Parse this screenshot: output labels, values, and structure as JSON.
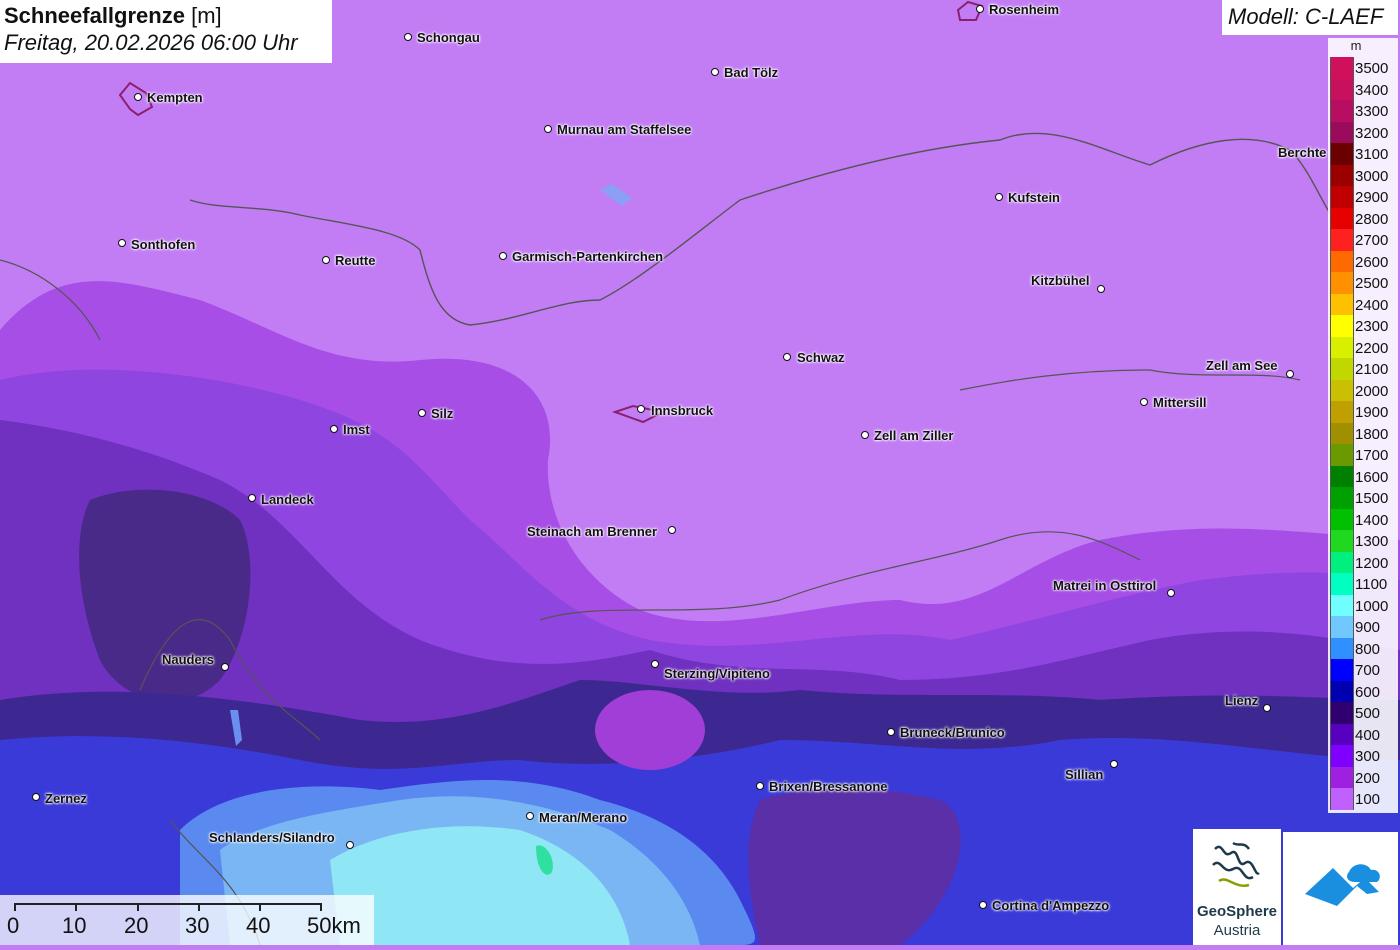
{
  "title": {
    "main": "Schneefallgrenze",
    "unit": "[m]",
    "datetime": "Freitag, 20.02.2026 06:00 Uhr"
  },
  "model": "Modell: C-LAEF",
  "legend": {
    "unit": "m",
    "entries": [
      {
        "label": "3500",
        "color": "#d0105a"
      },
      {
        "label": "3400",
        "color": "#c8105e"
      },
      {
        "label": "3300",
        "color": "#b80e62"
      },
      {
        "label": "3200",
        "color": "#9c0a5e"
      },
      {
        "label": "3100",
        "color": "#6b0000"
      },
      {
        "label": "3000",
        "color": "#9a0000"
      },
      {
        "label": "2900",
        "color": "#c00000"
      },
      {
        "label": "2800",
        "color": "#e60000"
      },
      {
        "label": "2700",
        "color": "#ff2020"
      },
      {
        "label": "2600",
        "color": "#ff6a00"
      },
      {
        "label": "2500",
        "color": "#ff9000"
      },
      {
        "label": "2400",
        "color": "#ffc000"
      },
      {
        "label": "2300",
        "color": "#ffff00"
      },
      {
        "label": "2200",
        "color": "#d8f000"
      },
      {
        "label": "2100",
        "color": "#c0d800"
      },
      {
        "label": "2000",
        "color": "#c8c000"
      },
      {
        "label": "1900",
        "color": "#c0a000"
      },
      {
        "label": "1800",
        "color": "#a09000"
      },
      {
        "label": "1700",
        "color": "#6a9a00"
      },
      {
        "label": "1600",
        "color": "#008000"
      },
      {
        "label": "1500",
        "color": "#00a000"
      },
      {
        "label": "1400",
        "color": "#00c000"
      },
      {
        "label": "1300",
        "color": "#20d820"
      },
      {
        "label": "1200",
        "color": "#00f080"
      },
      {
        "label": "1100",
        "color": "#00ffc0"
      },
      {
        "label": "1000",
        "color": "#70ffff"
      },
      {
        "label": "900",
        "color": "#70c8ff"
      },
      {
        "label": "800",
        "color": "#3090ff"
      },
      {
        "label": "700",
        "color": "#0000ff"
      },
      {
        "label": "600",
        "color": "#0000b0"
      },
      {
        "label": "500",
        "color": "#300070"
      },
      {
        "label": "400",
        "color": "#5800c0"
      },
      {
        "label": "300",
        "color": "#8000ff"
      },
      {
        "label": "200",
        "color": "#a020e0"
      },
      {
        "label": "100",
        "color": "#c060ff"
      }
    ]
  },
  "cities": [
    {
      "name": "Rosenheim"
    },
    {
      "name": "Schongau"
    },
    {
      "name": "Bad Tölz"
    },
    {
      "name": "Kempten"
    },
    {
      "name": "Murnau am Staffelsee"
    },
    {
      "name": "Berchte"
    },
    {
      "name": "Kufstein"
    },
    {
      "name": "Sonthofen"
    },
    {
      "name": "Reutte"
    },
    {
      "name": "Garmisch-Partenkirchen"
    },
    {
      "name": "Kitzbühel"
    },
    {
      "name": "Schwaz"
    },
    {
      "name": "Zell am See"
    },
    {
      "name": "Mittersill"
    },
    {
      "name": "Silz"
    },
    {
      "name": "Innsbruck"
    },
    {
      "name": "Imst"
    },
    {
      "name": "Zell am Ziller"
    },
    {
      "name": "Landeck"
    },
    {
      "name": "Steinach am Brenner"
    },
    {
      "name": "Matrei in Osttirol"
    },
    {
      "name": "Nauders"
    },
    {
      "name": "Sterzing/Vipiteno"
    },
    {
      "name": "Lienz"
    },
    {
      "name": "Bruneck/Brunico"
    },
    {
      "name": "Sillian"
    },
    {
      "name": "Brixen/Bressanone"
    },
    {
      "name": "Zernez"
    },
    {
      "name": "Meran/Merano"
    },
    {
      "name": "Schlanders/Silandro"
    },
    {
      "name": "Cortina d'Ampezzo"
    }
  ],
  "scalebar": {
    "labels": [
      "0",
      "10",
      "20",
      "30",
      "40",
      "50km"
    ]
  },
  "logos": {
    "geosphere_line1": "GeoSphere",
    "geosphere_line2": "Austria"
  }
}
